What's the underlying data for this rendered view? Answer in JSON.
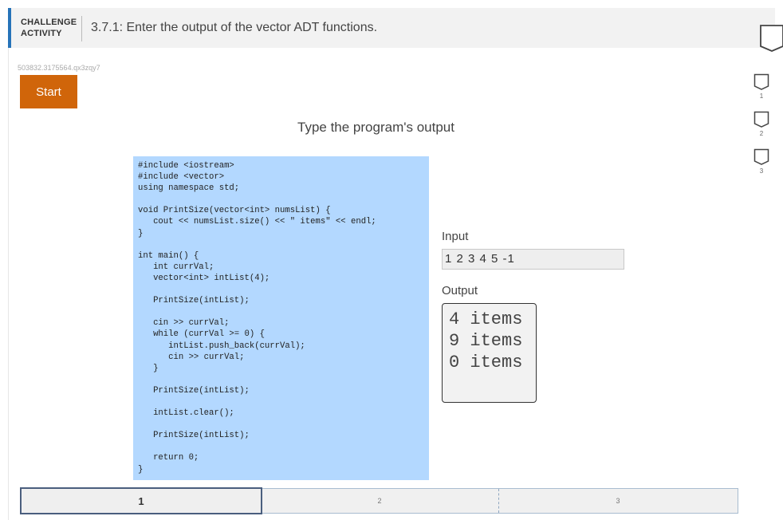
{
  "header": {
    "type_line1": "CHALLENGE",
    "type_line2": "ACTIVITY",
    "title": "3.7.1: Enter the output of the vector ADT functions."
  },
  "activity_id": "503832.3175564.qx3zqy7",
  "start_label": "Start",
  "prompt": "Type the program's output",
  "code_lines": [
    "#include <iostream>",
    "#include <vector>",
    "using namespace std;",
    "",
    "void PrintSize(vector<int> numsList) {",
    "   cout << numsList.size() << \" items\" << endl;",
    "}",
    "",
    "int main() {",
    "   int currVal;",
    "   vector<int> intList(4);",
    "",
    "   PrintSize(intList);",
    "",
    "   cin >> currVal;",
    "   while (currVal >= 0) {",
    "      intList.push_back(currVal);",
    "      cin >> currVal;",
    "   }",
    "",
    "   PrintSize(intList);",
    "",
    "   intList.clear();",
    "",
    "   PrintSize(intList);",
    "",
    "   return 0;",
    "}"
  ],
  "input": {
    "label": "Input",
    "value": "1 2 3 4 5 -1"
  },
  "output": {
    "label": "Output",
    "value": "4 items\n9 items\n0 items"
  },
  "levels": [
    "1",
    "2",
    "3"
  ],
  "progress": {
    "segments": [
      "1",
      "2",
      "3"
    ],
    "active": "1"
  },
  "colors": {
    "accent": "#2673b9",
    "start": "#d0650a",
    "code_bg": "#b3d8ff"
  }
}
